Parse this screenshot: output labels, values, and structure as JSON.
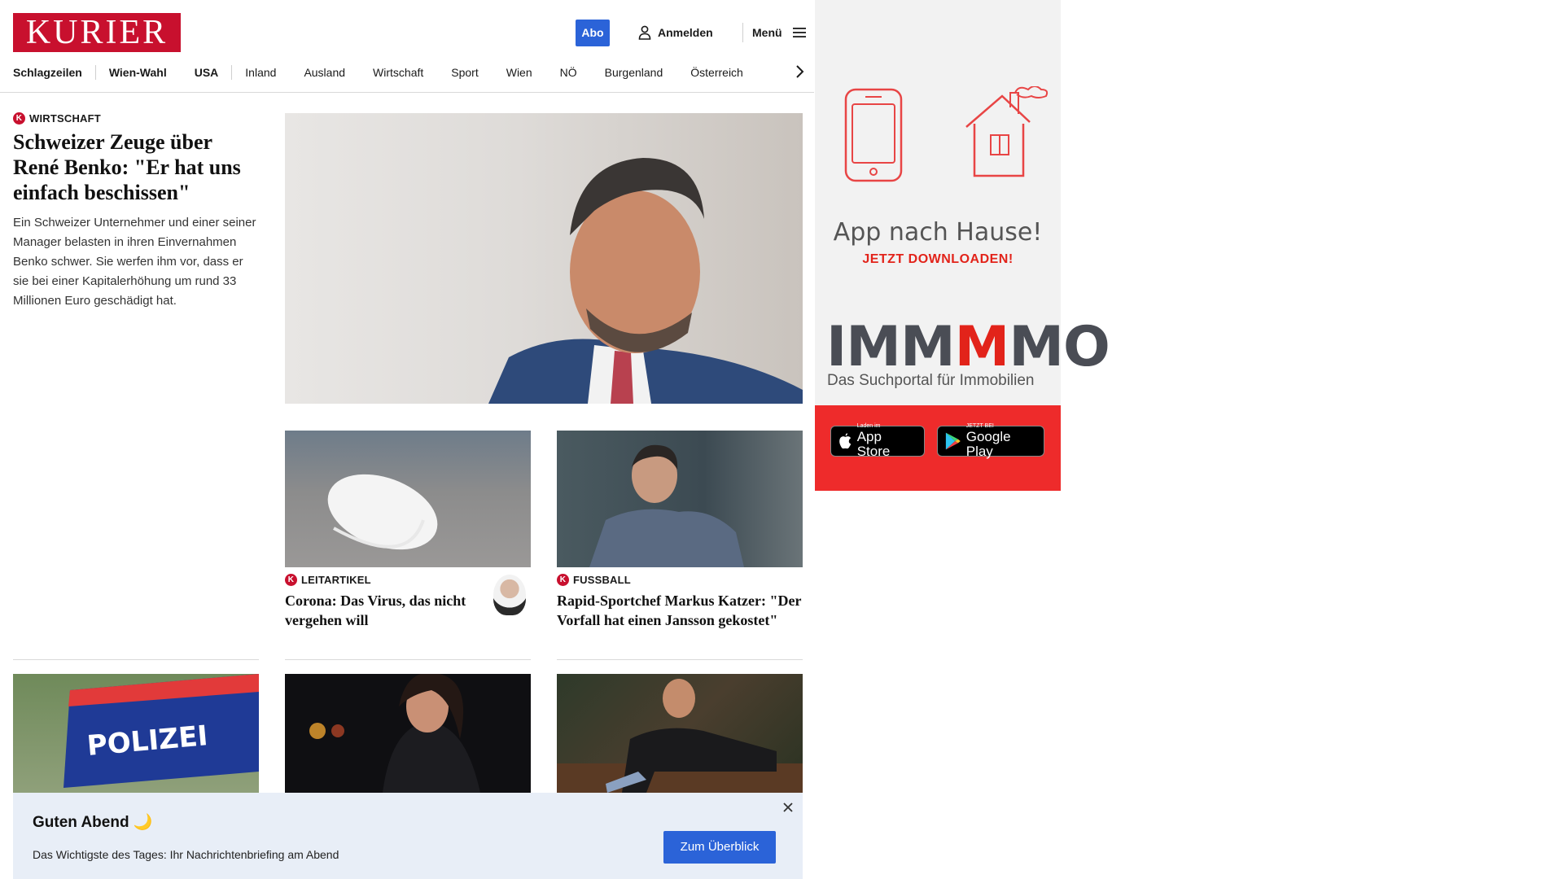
{
  "header": {
    "logo": "KURIER",
    "abo_label": "Abo",
    "login_label": "Anmelden",
    "menu_label": "Menü"
  },
  "nav": {
    "items": [
      "Schlagzeilen",
      "Wien-Wahl",
      "USA",
      "Inland",
      "Ausland",
      "Wirtschaft",
      "Sport",
      "Wien",
      "NÖ",
      "Burgenland",
      "Österreich"
    ]
  },
  "lead": {
    "kicker": "WIRTSCHAFT",
    "title": "Schweizer Zeuge über René Benko: \"Er hat uns einfach beschissen\"",
    "teaser": "Ein Schweizer Unternehmer und einer seiner Manager belasten in ihren Einvernahmen Benko schwer. Sie werfen ihm vor, dass er sie bei einer Kapitalerhöhung um rund 33 Millionen Euro geschädigt hat."
  },
  "stories": [
    {
      "kicker": "LEITARTIKEL",
      "title": "Corona: Das Virus, das nicht vergehen will"
    },
    {
      "kicker": "FUSSBALL",
      "title": "Rapid-Sportchef Markus Katzer: \"Der Vorfall hat einen Jansson gekostet\""
    }
  ],
  "police_sign": "POLIZEI",
  "ad": {
    "title": "App nach Hause!",
    "cta": "JETZT DOWNLOADEN!",
    "brand_a": "IMM",
    "brand_b": "M",
    "brand_c": "MO",
    "brand_sub": "Das Suchportal für Immobilien",
    "appstore_small": "Laden im",
    "appstore_big": "App Store",
    "googleplay_small": "JETZT BEI",
    "googleplay_big": "Google Play"
  },
  "briefing": {
    "title": "Guten Abend 🌙",
    "text": "Das Wichtigste des Tages: Ihr Nachrichtenbriefing am Abend",
    "button": "Zum Überblick"
  },
  "colors": {
    "brand_red": "#c8102e",
    "accent_blue": "#2b63d8",
    "ad_red": "#ee2b2b"
  }
}
